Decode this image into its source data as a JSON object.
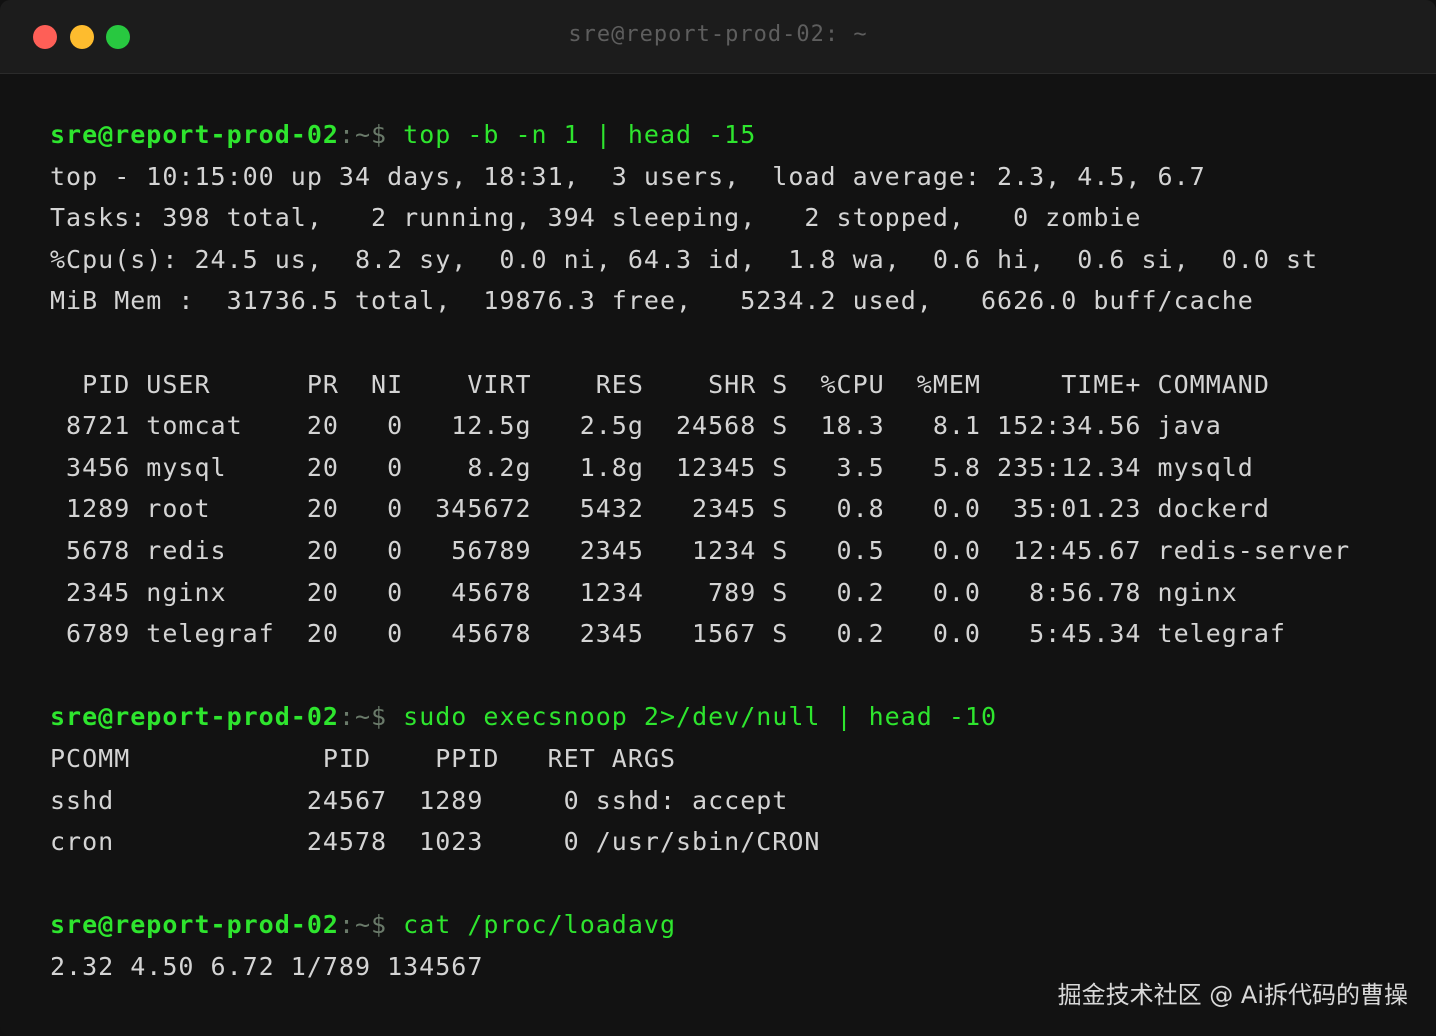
{
  "window": {
    "title": "sre@report-prod-02: ~"
  },
  "session": {
    "prompt_user_host": "sre@report-prod-02",
    "prompt_path": ":~$",
    "blocks": [
      {
        "command": " top -b -n 1 | head -15",
        "output": [
          "top - 10:15:00 up 34 days, 18:31,  3 users,  load average: 2.3, 4.5, 6.7",
          "Tasks: 398 total,   2 running, 394 sleeping,   2 stopped,   0 zombie",
          "%Cpu(s): 24.5 us,  8.2 sy,  0.0 ni, 64.3 id,  1.8 wa,  0.6 hi,  0.6 si,  0.0 st",
          "MiB Mem :  31736.5 total,  19876.3 free,   5234.2 used,   6626.0 buff/cache",
          "",
          "  PID USER      PR  NI    VIRT    RES    SHR S  %CPU  %MEM     TIME+ COMMAND",
          " 8721 tomcat    20   0   12.5g   2.5g  24568 S  18.3   8.1 152:34.56 java",
          " 3456 mysql     20   0    8.2g   1.8g  12345 S   3.5   5.8 235:12.34 mysqld",
          " 1289 root      20   0  345672   5432   2345 S   0.8   0.0  35:01.23 dockerd",
          " 5678 redis     20   0   56789   2345   1234 S   0.5   0.0  12:45.67 redis-server",
          " 2345 nginx     20   0   45678   1234    789 S   0.2   0.0   8:56.78 nginx",
          " 6789 telegraf  20   0   45678   2345   1567 S   0.2   0.0   5:45.34 telegraf"
        ]
      },
      {
        "command": " sudo execsnoop 2>/dev/null | head -10",
        "output": [
          "PCOMM            PID    PPID   RET ARGS",
          "sshd            24567  1289     0 sshd: accept",
          "cron            24578  1023     0 /usr/sbin/CRON"
        ]
      },
      {
        "command": " cat /proc/loadavg",
        "output": [
          "2.32 4.50 6.72 1/789 134567"
        ]
      }
    ]
  },
  "watermark": "掘金技术社区 @ Ai拆代码的曹操",
  "colors": {
    "background": "#121212",
    "titlebar": "#1c1c1c",
    "prompt_green": "#2ee52e",
    "text": "#d4d4d4",
    "close": "#fe5f57",
    "minimize": "#febc2e",
    "zoom": "#28c840"
  }
}
